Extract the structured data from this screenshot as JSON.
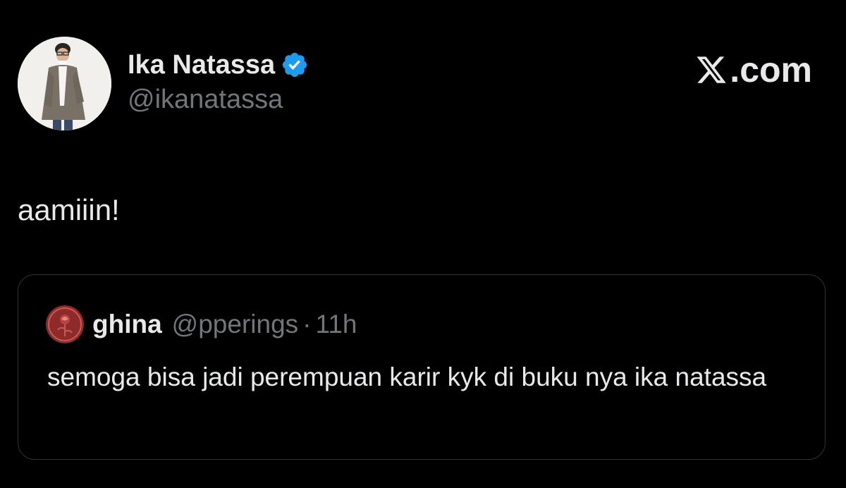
{
  "author": {
    "display_name": "Ika Natassa",
    "handle": "@ikanatassa",
    "verified_icon": "verified-badge-icon",
    "avatar_icon": "profile-photo"
  },
  "brand": {
    "label": ".com",
    "icon": "x-logo-icon"
  },
  "tweet": {
    "text": "aamiiin!"
  },
  "quoted_tweet": {
    "display_name": "ghina",
    "handle": "@pperings",
    "separator": "·",
    "time": "11h",
    "text": "semoga bisa jadi perempuan karir kyk di buku nya ika natassa",
    "avatar_icon": "rose-seal-avatar"
  },
  "colors": {
    "background": "#000000",
    "primary_text": "#e7e9ea",
    "secondary_text": "#71767b",
    "border": "#2f3336",
    "verified": "#1d9bf0"
  }
}
